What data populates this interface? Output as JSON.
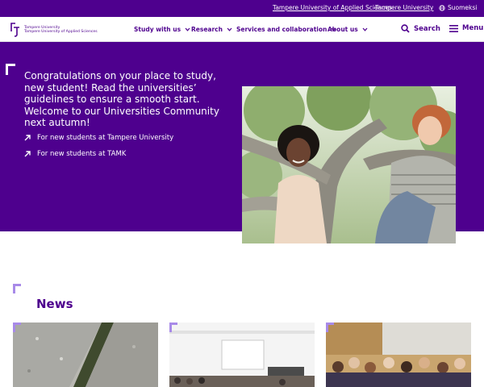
{
  "topbar": {
    "link_tamk": "Tampere University of Applied Sciences",
    "link_tuni": "Tampere University",
    "language": "Suomeksi"
  },
  "logo": {
    "line1": "Tampere University",
    "line2": "Tampere University of Applied Sciences"
  },
  "nav": {
    "items": [
      {
        "label": "Study with us"
      },
      {
        "label": "Research"
      },
      {
        "label": "Services and collaboration"
      },
      {
        "label": "About us"
      }
    ],
    "search_label": "Search",
    "menu_label": "Menu"
  },
  "hero": {
    "title": "Congratulations on your place to study, new student! Read the universities’ guidelines to ensure a smooth start. Welcome to our Universities Community next autumn!",
    "links": [
      {
        "label": "For new students at Tampere University"
      },
      {
        "label": "For new students at TAMK"
      }
    ]
  },
  "news": {
    "title": "News"
  },
  "colors": {
    "brand": "#4e008e",
    "accent": "#a88ae8",
    "background": "#ffffff"
  },
  "icons": [
    "globe-icon",
    "chevron-down-icon",
    "search-icon",
    "menu-icon",
    "arrow-up-right-icon",
    "corner-bracket-icon"
  ]
}
